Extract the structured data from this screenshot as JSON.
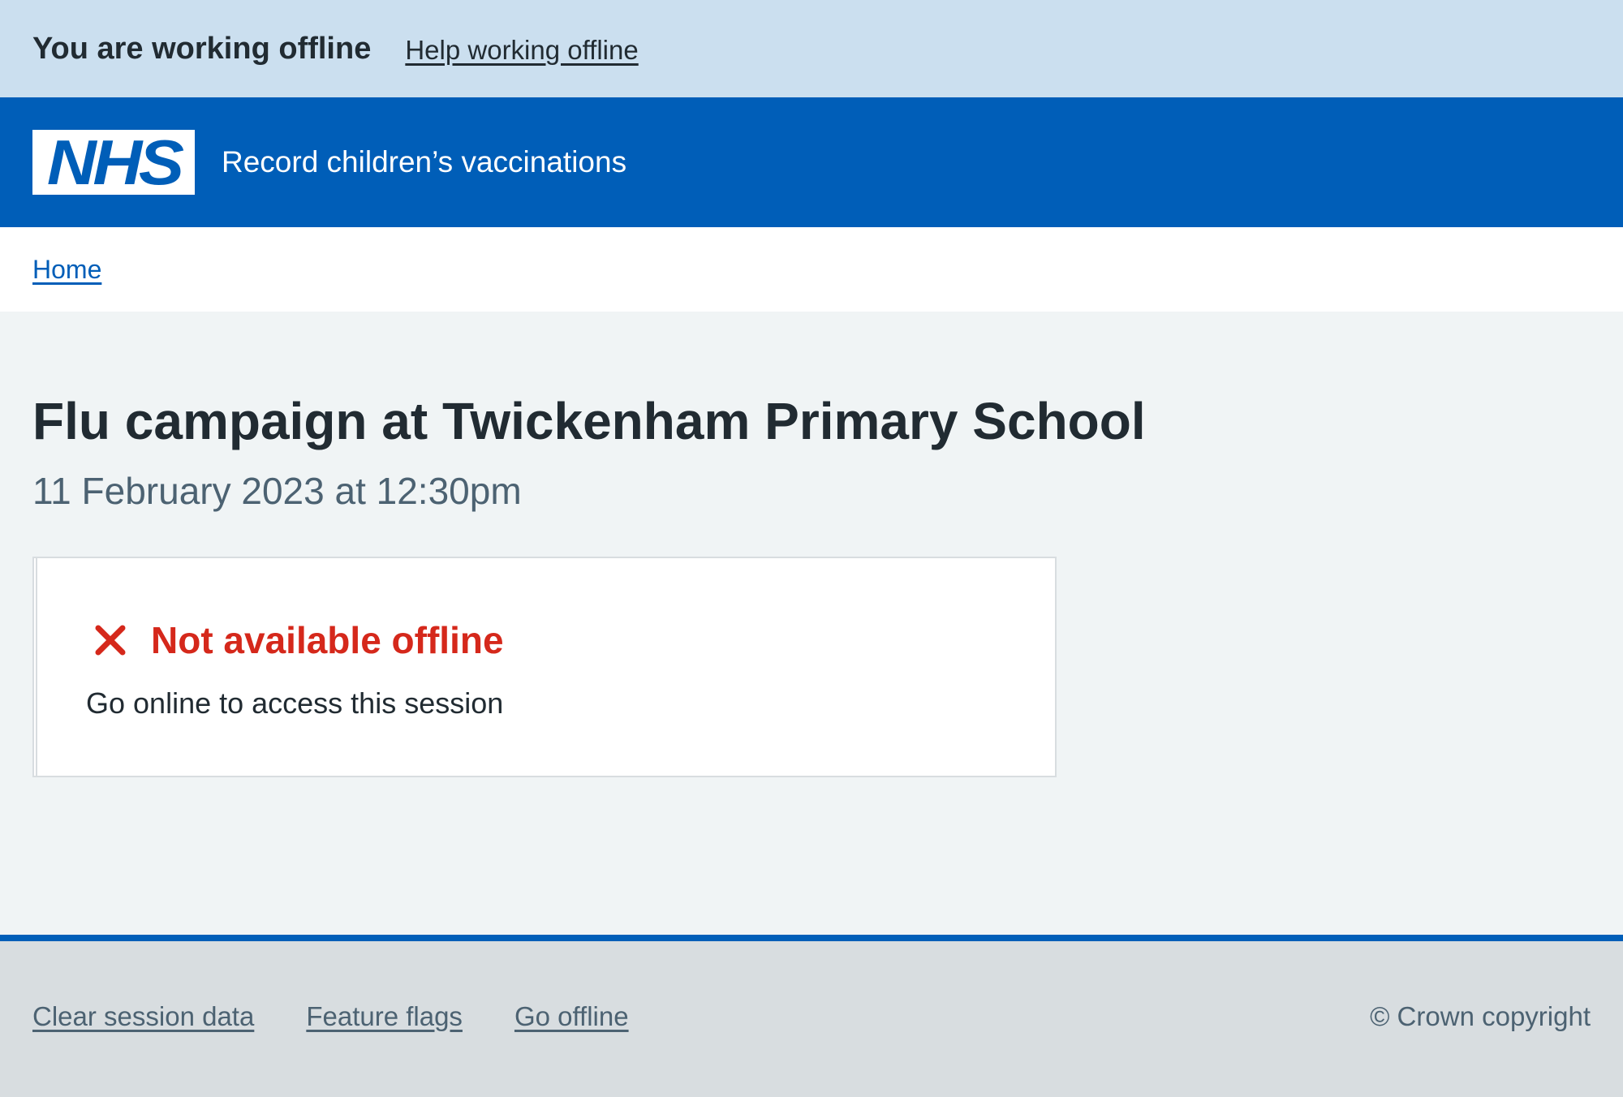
{
  "offline_banner": {
    "title": "You are working offline",
    "help_link": "Help working offline",
    "background": "#cbdfef"
  },
  "header": {
    "logo_text": "NHS",
    "service_name": "Record children’s vaccinations",
    "background": "#005eb8"
  },
  "breadcrumb": {
    "home": "Home"
  },
  "main": {
    "title": "Flu campaign at Twickenham Primary School",
    "caption": "11 February 2023 at 12:30pm",
    "card": {
      "icon": "cross-icon",
      "heading": "Not available offline",
      "body": "Go online to access this session",
      "status_color": "#d5281b"
    }
  },
  "footer": {
    "links": [
      "Clear session data",
      "Feature flags",
      "Go offline"
    ],
    "copyright": "© Crown copyright"
  }
}
